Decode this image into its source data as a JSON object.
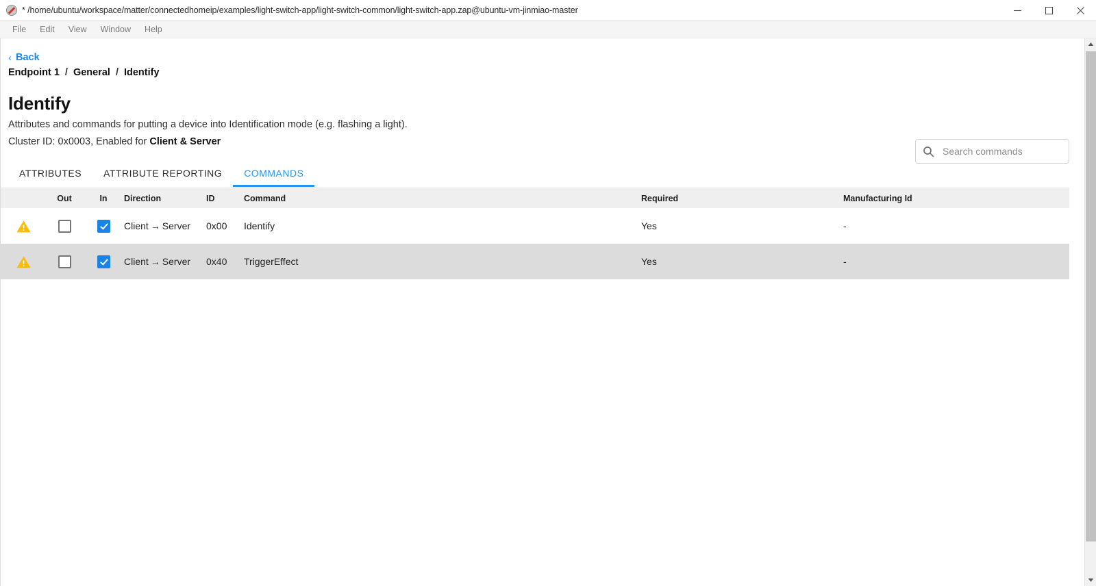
{
  "window": {
    "title": "* /home/ubuntu/workspace/matter/connectedhomeip/examples/light-switch-app/light-switch-common/light-switch-app.zap@ubuntu-vm-jinmiao-master",
    "app_icon": "zap-app-icon",
    "controls": {
      "minimize": "minimize-icon",
      "maximize": "maximize-icon",
      "close": "close-icon"
    }
  },
  "menubar": {
    "items": [
      {
        "label": "File"
      },
      {
        "label": "Edit"
      },
      {
        "label": "View"
      },
      {
        "label": "Window"
      },
      {
        "label": "Help"
      }
    ]
  },
  "nav": {
    "back_label": "Back",
    "back_icon": "chevron-left-icon",
    "breadcrumb": [
      "Endpoint 1",
      "General",
      "Identify"
    ],
    "breadcrumb_separator": "/"
  },
  "header": {
    "title": "Identify",
    "description": "Attributes and commands for putting a device into Identification mode (e.g. flashing a light).",
    "cluster_prefix": "Cluster ID: 0x0003, Enabled for ",
    "cluster_enabled_for": "Client & Server"
  },
  "search": {
    "placeholder": "Search commands",
    "value": "",
    "icon": "search-icon"
  },
  "tabs": [
    {
      "label": "ATTRIBUTES",
      "active": false
    },
    {
      "label": "ATTRIBUTE REPORTING",
      "active": false
    },
    {
      "label": "COMMANDS",
      "active": true
    }
  ],
  "table": {
    "columns": {
      "warn": "",
      "out": "Out",
      "in": "In",
      "direction": "Direction",
      "id": "ID",
      "command": "Command",
      "required": "Required",
      "manufacturing_id": "Manufacturing Id"
    },
    "rows": [
      {
        "warning": "warning-triangle-icon",
        "out_checked": false,
        "in_checked": true,
        "direction_from": "Client",
        "direction_arrow": "→",
        "direction_to": "Server",
        "id": "0x00",
        "command": "Identify",
        "required": "Yes",
        "manufacturing_id": "-"
      },
      {
        "warning": "warning-triangle-icon",
        "out_checked": false,
        "in_checked": true,
        "direction_from": "Client",
        "direction_arrow": "→",
        "direction_to": "Server",
        "id": "0x40",
        "command": "TriggerEffect",
        "required": "Yes",
        "manufacturing_id": "-"
      }
    ]
  },
  "colors": {
    "accent": "#2196f3",
    "link": "#1e88e5",
    "checkbox_checked": "#1a83e8",
    "warning": "#fbbc05",
    "header_row_bg": "#efefef",
    "alt_row_bg": "#dcdcdc"
  },
  "scrollbar": {
    "up_arrow": "scroll-up-arrow-icon",
    "down_arrow": "scroll-down-arrow-icon"
  }
}
